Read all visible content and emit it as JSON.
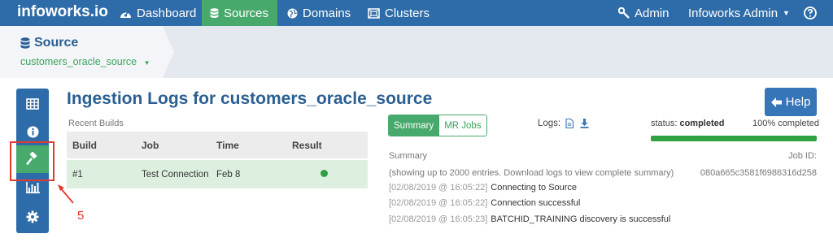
{
  "nav": {
    "brand": "infoworks.io",
    "items": [
      {
        "label": "Dashboard",
        "icon": "dashboard-icon",
        "active": false
      },
      {
        "label": "Sources",
        "icon": "database-icon",
        "active": true
      },
      {
        "label": "Domains",
        "icon": "globe-icon",
        "active": false
      },
      {
        "label": "Clusters",
        "icon": "cluster-icon",
        "active": false
      }
    ],
    "admin_label": "Admin",
    "user_label": "Infoworks Admin",
    "help_icon": "question-circle-icon"
  },
  "breadcrumb": {
    "title": "Source",
    "current": "customers_oracle_source"
  },
  "rail": {
    "items": [
      "table-icon",
      "info-icon",
      "gavel-icon",
      "bar-chart-icon",
      "gear-icon"
    ],
    "active_index": 2
  },
  "annotation": {
    "number": "5",
    "color": "#e23b2e"
  },
  "page": {
    "title": "Ingestion Logs for customers_oracle_source",
    "help_label": "Help"
  },
  "builds": {
    "caption": "Recent Builds",
    "headers": [
      "Build",
      "Job",
      "Time",
      "Result"
    ],
    "rows": [
      {
        "build": "#1",
        "job": "Test Connection",
        "time": "Feb 8",
        "result": "success"
      }
    ]
  },
  "details": {
    "tabs": [
      "Summary",
      "MR Jobs"
    ],
    "active_tab": 0,
    "logs_label": "Logs:",
    "status_prefix": "status:",
    "status_value": "completed",
    "percent_label": "100% completed",
    "progress": 1.0,
    "summary_label": "Summary",
    "summary_note": "(showing up to 2000 entries. Download logs to view complete summary)",
    "job_id_label": "Job ID:",
    "job_id_value": "080a665c3581f6986316d258",
    "log_entries": [
      {
        "ts": "[02/08/2019 @ 16:05:22]",
        "msg": "Connecting to Source"
      },
      {
        "ts": "[02/08/2019 @ 16:05:22]",
        "msg": "Connection successful"
      },
      {
        "ts": "[02/08/2019 @ 16:05:23]",
        "msg": "BATCHID_TRAINING discovery is successful"
      }
    ]
  },
  "colors": {
    "nav": "#2d6ca8",
    "accent_green": "#47a96b",
    "title_blue": "#2b5f92"
  }
}
